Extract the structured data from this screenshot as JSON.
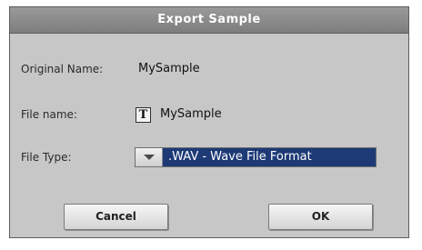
{
  "dialog": {
    "title": "Export Sample"
  },
  "fields": {
    "original_name_label": "Original Name:",
    "original_name_value": "MySample",
    "file_name_label": "File name:",
    "file_name_icon_glyph": "T",
    "file_name_value": "MySample",
    "file_type_label": "File Type:",
    "file_type_value": ".WAV - Wave File Format"
  },
  "buttons": {
    "cancel_label": "Cancel",
    "ok_label": "OK"
  },
  "colors": {
    "dialog_bg": "#c7c7c7",
    "title_bg": "#8a8a8a",
    "dropdown_selected_bg": "#1d3a76"
  },
  "icons": {
    "text_edit": "text-edit-icon",
    "dropdown": "chevron-down-icon"
  }
}
